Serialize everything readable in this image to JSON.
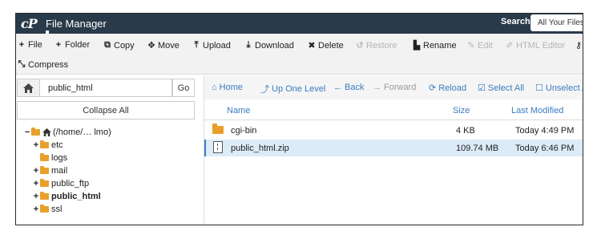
{
  "app": {
    "logo_text": "cP",
    "title": "File Manager",
    "search_label": "Search",
    "search_scope": "All Your Files"
  },
  "toolbar": {
    "row1": [
      {
        "icon": "plus-icon",
        "glyph": "+",
        "label": "File",
        "enabled": true
      },
      {
        "icon": "plus-icon",
        "glyph": "+",
        "label": "Folder",
        "enabled": true
      },
      {
        "icon": "copy-icon",
        "glyph": "⧉",
        "label": "Copy",
        "enabled": true
      },
      {
        "icon": "move-icon",
        "glyph": "✥",
        "label": "Move",
        "enabled": true
      },
      {
        "icon": "upload-icon",
        "glyph": "⤒",
        "label": "Upload",
        "enabled": true
      },
      {
        "icon": "download-icon",
        "glyph": "⤓",
        "label": "Download",
        "enabled": true
      },
      {
        "icon": "delete-icon",
        "glyph": "✖",
        "label": "Delete",
        "enabled": true
      },
      {
        "icon": "restore-icon",
        "glyph": "↺",
        "label": "Restore",
        "enabled": false
      },
      {
        "icon": "rename-icon",
        "glyph": "▙",
        "label": "Rename",
        "enabled": true
      },
      {
        "icon": "edit-icon",
        "glyph": "✎",
        "label": "Edit",
        "enabled": false
      },
      {
        "icon": "html-editor-icon",
        "glyph": "✐",
        "label": "HTML Editor",
        "enabled": false
      },
      {
        "icon": "key-icon",
        "glyph": "⚷",
        "label": "",
        "enabled": true
      }
    ],
    "row2": [
      {
        "icon": "compress-icon",
        "glyph": "⤡",
        "label": "Compress",
        "enabled": true
      }
    ]
  },
  "left_panel": {
    "path_value": "public_html",
    "go_label": "Go",
    "collapse_label": "Collapse All",
    "tree": [
      {
        "toggle": "−",
        "icon": "home-folder",
        "label": "(/home/… lmo)",
        "bold": false,
        "depth": 0
      },
      {
        "toggle": "+",
        "icon": "folder",
        "label": "etc",
        "bold": false,
        "depth": 1
      },
      {
        "toggle": "",
        "icon": "folder",
        "label": "logs",
        "bold": false,
        "depth": 1
      },
      {
        "toggle": "+",
        "icon": "folder",
        "label": "mail",
        "bold": false,
        "depth": 1
      },
      {
        "toggle": "+",
        "icon": "folder",
        "label": "public_ftp",
        "bold": false,
        "depth": 1
      },
      {
        "toggle": "+",
        "icon": "folder",
        "label": "public_html",
        "bold": true,
        "depth": 1
      },
      {
        "toggle": "+",
        "icon": "folder",
        "label": "ssl",
        "bold": false,
        "depth": 1
      }
    ]
  },
  "nav": {
    "items": [
      {
        "icon": "home-icon",
        "glyph": "⌂",
        "label": "Home",
        "enabled": true
      },
      {
        "icon": "level-up-icon",
        "glyph": "⤴",
        "label": "Up One Level",
        "enabled": true
      },
      {
        "icon": "back-arrow-icon",
        "glyph": "←",
        "label": "Back",
        "enabled": true
      },
      {
        "icon": "forward-arrow-icon",
        "glyph": "→",
        "label": "Forward",
        "enabled": false
      },
      {
        "icon": "reload-icon",
        "glyph": "⟳",
        "label": "Reload",
        "enabled": true
      },
      {
        "icon": "select-all-icon",
        "glyph": "☑",
        "label": "Select All",
        "enabled": true
      },
      {
        "icon": "unselect-icon",
        "glyph": "☐",
        "label": "Unselect A",
        "enabled": true
      }
    ]
  },
  "file_list": {
    "columns": [
      "Name",
      "Size",
      "Last Modified"
    ],
    "rows": [
      {
        "type": "folder",
        "name": "cgi-bin",
        "size": "4 KB",
        "modified": "Today 4:49 PM",
        "selected": false
      },
      {
        "type": "zip",
        "name": "public_html.zip",
        "size": "109.74 MB",
        "modified": "Today 6:46 PM",
        "selected": true
      }
    ]
  },
  "colors": {
    "titlebar": "#293a4a",
    "link": "#3a7cc0",
    "folder": "#e8a02a",
    "selected_row": "#dcebf8"
  }
}
